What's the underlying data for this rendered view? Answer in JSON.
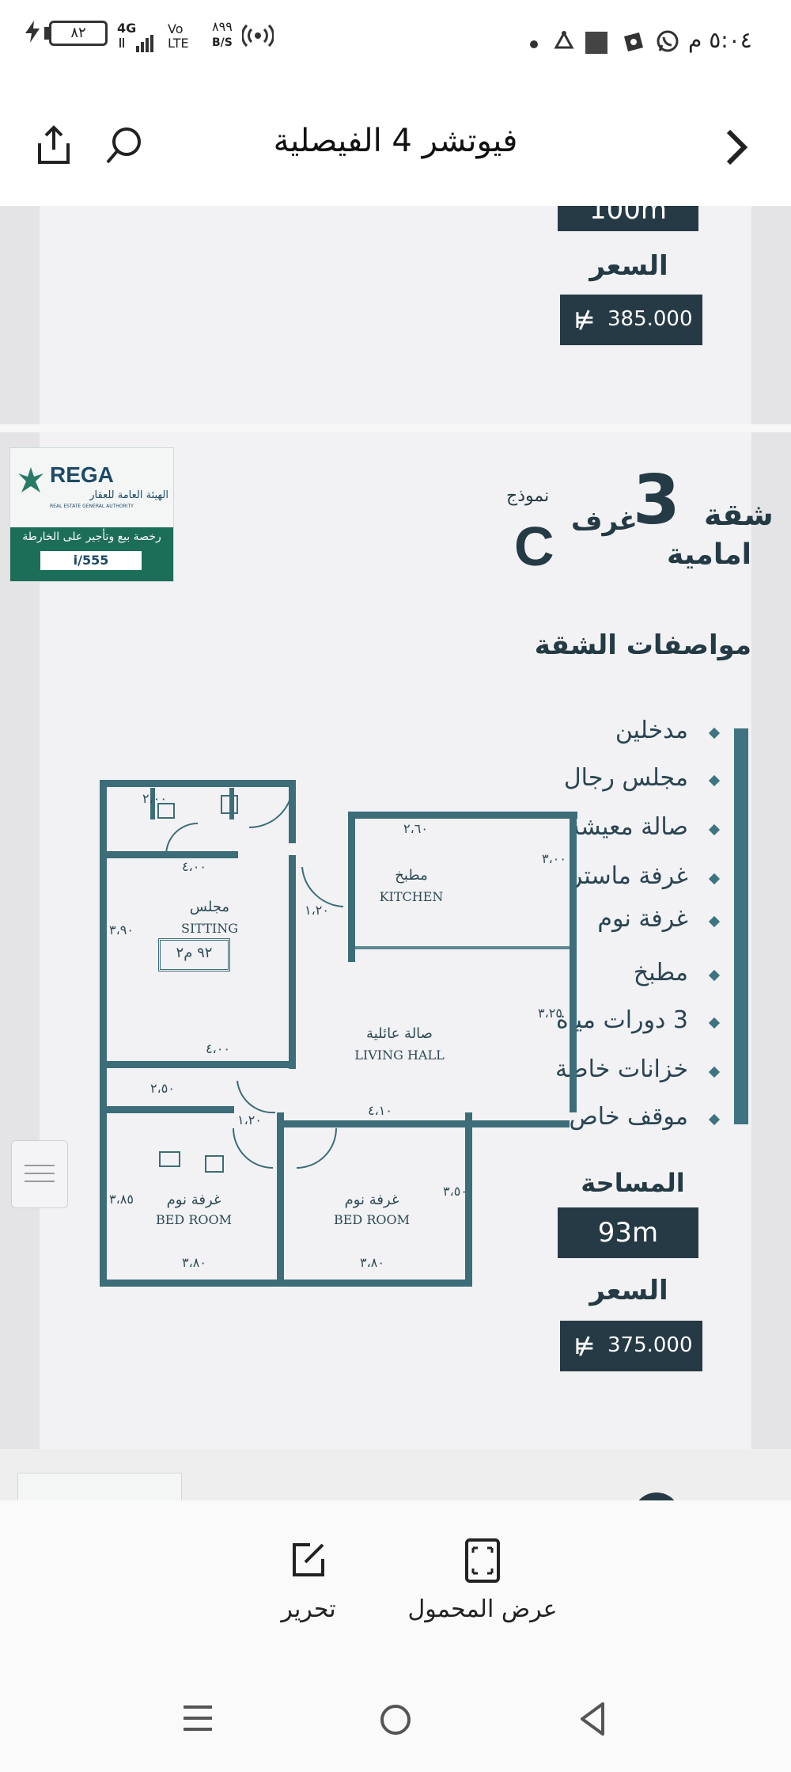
{
  "status_bar": {
    "time": "٥:٠٤ م",
    "battery": "٨٢",
    "network": "4G",
    "volte": "Vo LTE",
    "speed_value": "٨٩٩",
    "speed_unit": "B/S"
  },
  "header": {
    "title": "فيوتشر 4 الفيصلية"
  },
  "prev_card": {
    "area_partial": "100m",
    "price_label": "السعر",
    "price": "385.000"
  },
  "listing": {
    "rega": {
      "brand": "REGA",
      "name_ar": "الهيئة العامة للعقار",
      "name_en": "REAL ESTATE GENERAL AUTHORITY",
      "license_text": "رخصة بيع وتأجير على الخارطة",
      "license_no": "i/555"
    },
    "heading": {
      "line1_word": "شقة",
      "rooms_number": "3",
      "rooms_word": "غرف",
      "model_word": "نموذج",
      "model_letter": "C",
      "facing": "امامية"
    },
    "specs_title": "مواصفات الشقة",
    "specs": [
      "مدخلين",
      "مجلس رجال",
      "صالة معيشة",
      "غرفة ماستر",
      "غرفة نوم",
      "مطبخ",
      "3 دورات مياة",
      "خزانات خاصة",
      "موقف خاص"
    ],
    "area_label": "المساحة",
    "area_value": "93m",
    "price_label": "السعر",
    "price": "375.000",
    "floorplan": {
      "sitting_ar": "مجلس",
      "sitting_en": "SITTING",
      "sitting_area": "٩٢ م٢",
      "kitchen_ar": "مطبخ",
      "kitchen_en": "KITCHEN",
      "living_ar": "صالة عائلية",
      "living_en": "LIVING HALL",
      "bed1_ar": "غرفة نوم",
      "bed1_en": "BED ROOM",
      "bed2_ar": "غرفة نوم",
      "bed2_en": "BED ROOM",
      "dims": [
        "٢،٦٠",
        "٢،٠٠",
        "٤،٠٠",
        "٣،٩٠",
        "١،٢٠",
        "٤،٠٠",
        "٢،٥٠",
        "١،٢٠",
        "٤،١٠",
        "٣،٢٥",
        "٣،٨٠",
        "٣،٨٠",
        "٣،٠٠",
        "٣،٥٠",
        "٣،٨٥"
      ]
    }
  },
  "bottom_bar": {
    "edit_label": "تحرير",
    "view_label": "عرض المحمول"
  },
  "colors": {
    "dark_box": "#263a45",
    "accent_teal": "#3c6d78",
    "rega_green": "#1c6e58"
  }
}
